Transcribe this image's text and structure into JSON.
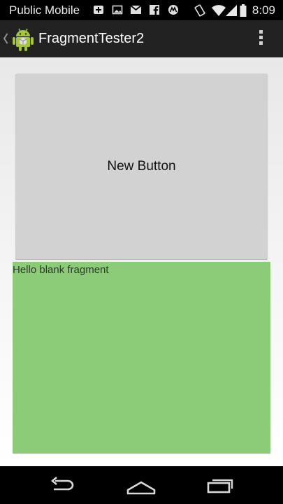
{
  "status_bar": {
    "carrier": "Public Mobile",
    "time": "8:09",
    "icons": [
      "notification-icon",
      "image-icon",
      "gmail-icon",
      "facebook-icon",
      "motorola-icon",
      "vibrate-icon",
      "wifi-icon",
      "signal-icon",
      "battery-icon"
    ]
  },
  "action_bar": {
    "title": "FragmentTester2",
    "icons": [
      "back-chevron-icon",
      "android-app-icon",
      "overflow-menu-icon"
    ]
  },
  "main": {
    "button_label": "New Button",
    "fragment_text": "Hello blank fragment"
  },
  "nav_bar": {
    "icons": [
      "back-icon",
      "home-icon",
      "recent-apps-icon"
    ]
  },
  "colors": {
    "status_bar": "#000000",
    "action_bar": "#222222",
    "button": "#d2d2d2",
    "fragment": "#8ccb78",
    "nav_bar": "#000000"
  }
}
